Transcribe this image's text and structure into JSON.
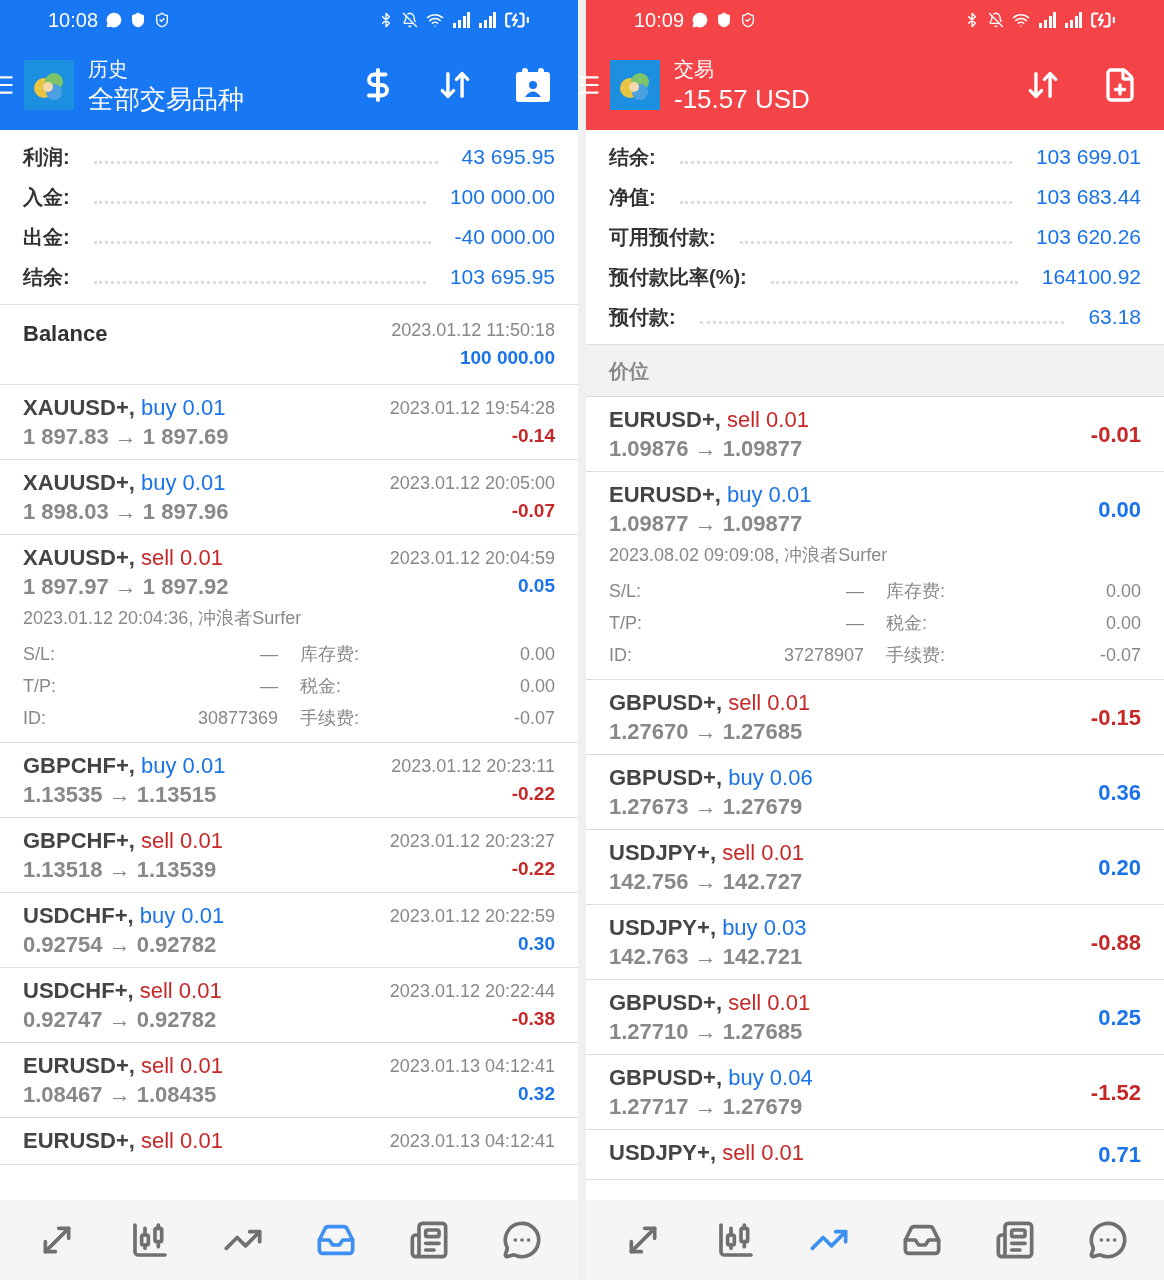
{
  "phones": [
    {
      "kind": "history",
      "status_bar": {
        "time": "10:08"
      },
      "header": {
        "title": "历史",
        "subtitle": "全部交易品种"
      },
      "summary": [
        {
          "label": "利润:",
          "value": "43 695.95"
        },
        {
          "label": "入金:",
          "value": "100 000.00"
        },
        {
          "label": "出金:",
          "value": "-40 000.00"
        },
        {
          "label": "结余:",
          "value": "103 695.95"
        }
      ],
      "items": [
        {
          "kind": "balance",
          "label": "Balance",
          "time": "2023.01.12 11:50:18",
          "amount": "100 000.00"
        },
        {
          "kind": "deal",
          "symbol": "XAUUSD+,",
          "order": "buy 0.01",
          "sell": false,
          "prices": "1 897.83 → 1 897.69",
          "time": "2023.01.12 19:54:28",
          "profit": "-0.14",
          "loss": true
        },
        {
          "kind": "deal",
          "symbol": "XAUUSD+,",
          "order": "buy 0.01",
          "sell": false,
          "prices": "1 898.03 → 1 897.96",
          "time": "2023.01.12 20:05:00",
          "profit": "-0.07",
          "loss": true
        },
        {
          "kind": "deal",
          "symbol": "XAUUSD+,",
          "order": "sell 0.01",
          "sell": true,
          "prices": "1 897.97 → 1 897.92",
          "time": "2023.01.12 20:04:59",
          "profit": "0.05",
          "loss": false,
          "details": {
            "opened": "2023.01.12 20:04:36, 冲浪者Surfer",
            "fields": [
              {
                "label": "S/L:",
                "value": "—"
              },
              {
                "label": "库存费:",
                "value": "0.00"
              },
              {
                "label": "T/P:",
                "value": "—"
              },
              {
                "label": "税金:",
                "value": "0.00"
              },
              {
                "label": "ID:",
                "value": "30877369"
              },
              {
                "label": "手续费:",
                "value": "-0.07"
              }
            ]
          }
        },
        {
          "kind": "deal",
          "symbol": "GBPCHF+,",
          "order": "buy 0.01",
          "sell": false,
          "prices": "1.13535 → 1.13515",
          "time": "2023.01.12 20:23:11",
          "profit": "-0.22",
          "loss": true
        },
        {
          "kind": "deal",
          "symbol": "GBPCHF+,",
          "order": "sell 0.01",
          "sell": true,
          "prices": "1.13518 → 1.13539",
          "time": "2023.01.12 20:23:27",
          "profit": "-0.22",
          "loss": true
        },
        {
          "kind": "deal",
          "symbol": "USDCHF+,",
          "order": "buy 0.01",
          "sell": false,
          "prices": "0.92754 → 0.92782",
          "time": "2023.01.12 20:22:59",
          "profit": "0.30",
          "loss": false
        },
        {
          "kind": "deal",
          "symbol": "USDCHF+,",
          "order": "sell 0.01",
          "sell": true,
          "prices": "0.92747 → 0.92782",
          "time": "2023.01.12 20:22:44",
          "profit": "-0.38",
          "loss": true
        },
        {
          "kind": "deal",
          "symbol": "EURUSD+,",
          "order": "sell 0.01",
          "sell": true,
          "prices": "1.08467 → 1.08435",
          "time": "2023.01.13 04:12:41",
          "profit": "0.32",
          "loss": false
        },
        {
          "kind": "deal",
          "symbol": "EURUSD+,",
          "order": "sell 0.01",
          "sell": true,
          "time": "2023.01.13 04:12:41"
        }
      ],
      "nav": [
        {
          "selected": false
        },
        {
          "selected": false
        },
        {
          "selected": false
        },
        {
          "selected": true
        },
        {
          "selected": false
        },
        {
          "selected": false
        }
      ]
    },
    {
      "kind": "trade",
      "status_bar": {
        "time": "10:09"
      },
      "header": {
        "title": "交易",
        "subtitle": "-15.57 USD"
      },
      "summary": [
        {
          "label": "结余:",
          "value": "103 699.01"
        },
        {
          "label": "净值:",
          "value": "103 683.44"
        },
        {
          "label": "可用预付款:",
          "value": "103 620.26"
        },
        {
          "label": "预付款比率(%):",
          "value": "164100.92"
        },
        {
          "label": "预付款:",
          "value": "63.18"
        }
      ],
      "section_title": "价位",
      "items": [
        {
          "kind": "deal",
          "symbol": "EURUSD+,",
          "order": "sell 0.01",
          "sell": true,
          "prices": "1.09876 → 1.09877",
          "profit": "-0.01",
          "loss": true
        },
        {
          "kind": "deal",
          "symbol": "EURUSD+,",
          "order": "buy 0.01",
          "sell": false,
          "prices": "1.09877 → 1.09877",
          "profit": "0.00",
          "loss": false,
          "details": {
            "opened": "2023.08.02 09:09:08, 冲浪者Surfer",
            "fields": [
              {
                "label": "S/L:",
                "value": "—"
              },
              {
                "label": "库存费:",
                "value": "0.00"
              },
              {
                "label": "T/P:",
                "value": "—"
              },
              {
                "label": "税金:",
                "value": "0.00"
              },
              {
                "label": "ID:",
                "value": "37278907"
              },
              {
                "label": "手续费:",
                "value": "-0.07"
              }
            ]
          }
        },
        {
          "kind": "deal",
          "symbol": "GBPUSD+,",
          "order": "sell 0.01",
          "sell": true,
          "prices": "1.27670 → 1.27685",
          "profit": "-0.15",
          "loss": true
        },
        {
          "kind": "deal",
          "symbol": "GBPUSD+,",
          "order": "buy 0.06",
          "sell": false,
          "prices": "1.27673 → 1.27679",
          "profit": "0.36",
          "loss": false
        },
        {
          "kind": "deal",
          "symbol": "USDJPY+,",
          "order": "sell 0.01",
          "sell": true,
          "prices": "142.756 → 142.727",
          "profit": "0.20",
          "loss": false
        },
        {
          "kind": "deal",
          "symbol": "USDJPY+,",
          "order": "buy 0.03",
          "sell": false,
          "prices": "142.763 → 142.721",
          "profit": "-0.88",
          "loss": true
        },
        {
          "kind": "deal",
          "symbol": "GBPUSD+,",
          "order": "sell 0.01",
          "sell": true,
          "prices": "1.27710 → 1.27685",
          "profit": "0.25",
          "loss": false
        },
        {
          "kind": "deal",
          "symbol": "GBPUSD+,",
          "order": "buy 0.04",
          "sell": false,
          "prices": "1.27717 → 1.27679",
          "profit": "-1.52",
          "loss": true
        },
        {
          "kind": "deal",
          "symbol": "USDJPY+,",
          "order": "sell 0.01",
          "sell": true,
          "profit": "0.71",
          "loss": false
        }
      ],
      "nav": [
        {
          "selected": false
        },
        {
          "selected": false
        },
        {
          "selected": true
        },
        {
          "selected": false
        },
        {
          "selected": false
        },
        {
          "selected": false
        }
      ]
    }
  ]
}
